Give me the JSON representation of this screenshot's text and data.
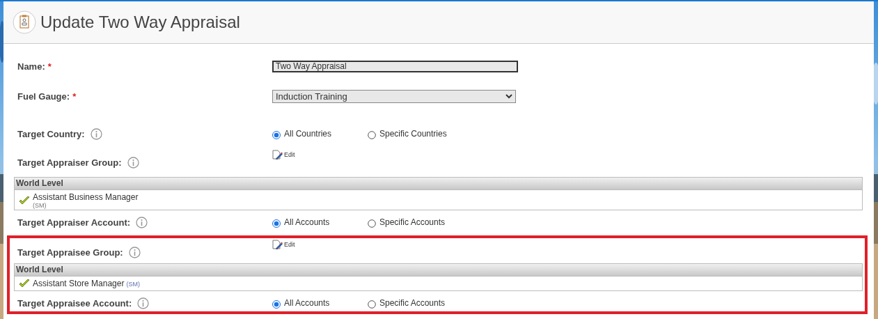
{
  "header": {
    "title": "Update Two Way Appraisal"
  },
  "sections": [
    {
      "highlighted": false,
      "fields": [
        {
          "kind": "text",
          "label": "Name:",
          "required_mark": "*",
          "value": "Two Way Appraisal"
        },
        {
          "kind": "select",
          "label": "Fuel Gauge:",
          "required_mark": "*",
          "value": "Induction Training"
        },
        {
          "kind": "radio",
          "label": "Target Country:",
          "info": true,
          "options": [
            {
              "label": "All Countries",
              "selected": true
            },
            {
              "label": "Specific Countries",
              "selected": false
            }
          ]
        },
        {
          "kind": "group",
          "label": "Target Appraiser Group:",
          "info": true,
          "edit": "Edit",
          "table": {
            "heading": "World Level",
            "items": [
              {
                "name": "Assistant Business Manager",
                "code": "(SM)",
                "stacked": true
              }
            ]
          }
        },
        {
          "kind": "radio",
          "label": "Target Appraiser Account:",
          "info": true,
          "options": [
            {
              "label": "All Accounts",
              "selected": true
            },
            {
              "label": "Specific Accounts",
              "selected": false
            }
          ]
        }
      ]
    },
    {
      "highlighted": true,
      "fields": [
        {
          "kind": "group",
          "label": "Target Appraisee Group:",
          "info": true,
          "edit": "Edit",
          "table": {
            "heading": "World Level",
            "items": [
              {
                "name": "Assistant Store Manager",
                "code": "(SM)",
                "stacked": false
              }
            ]
          }
        },
        {
          "kind": "radio",
          "label": "Target Appraisee Account:",
          "info": true,
          "options": [
            {
              "label": "All Accounts",
              "selected": true
            },
            {
              "label": "Specific Accounts",
              "selected": false
            }
          ]
        }
      ]
    }
  ]
}
